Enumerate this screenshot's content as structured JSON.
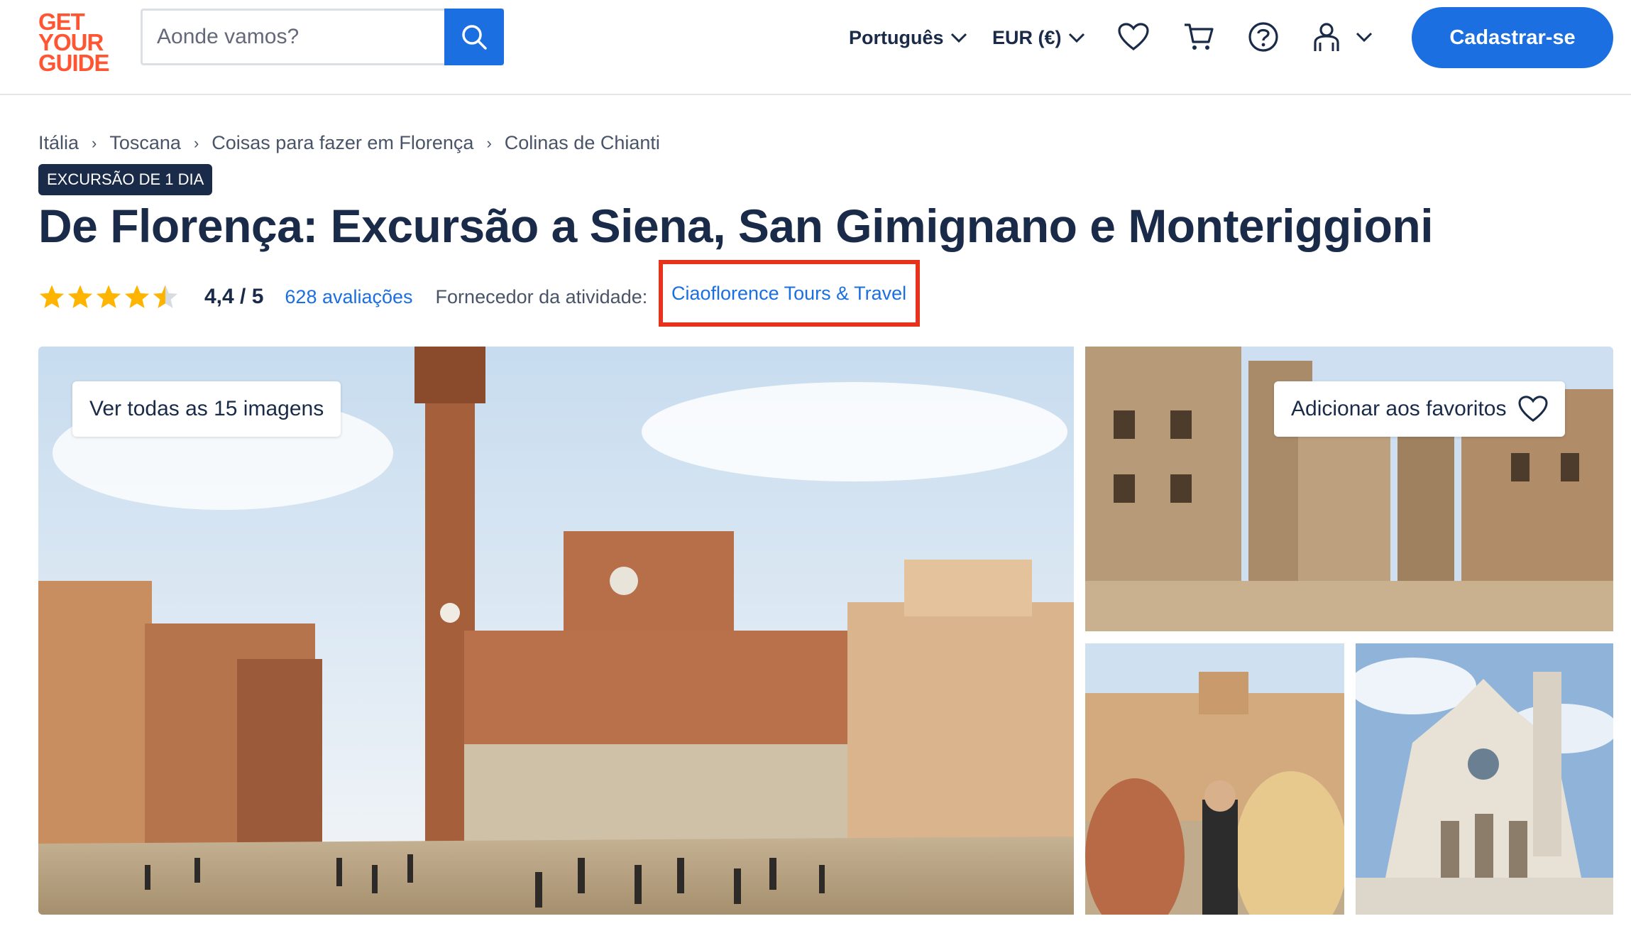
{
  "header": {
    "logo_lines": [
      "GET",
      "YOUR",
      "GUIDE"
    ],
    "search_placeholder": "Aonde vamos?",
    "language": "Português",
    "currency": "EUR (€)",
    "signup_label": "Cadastrar-se"
  },
  "breadcrumb": [
    "Itália",
    "Toscana",
    "Coisas para fazer em Florença",
    "Colinas de Chianti"
  ],
  "badge": "EXCURSÃO DE 1 DIA",
  "title": "De Florença: Excursão a Siena, San Gimignano e Monteriggioni",
  "rating": {
    "value": 4.4,
    "score_text": "4,4 / 5",
    "reviews_text": "628 avaliações",
    "provider_label": "Fornecedor da atividade:",
    "provider_name": "Ciaoflorence Tours & Travel"
  },
  "gallery": {
    "view_all_label": "Ver todas as 15 imagens",
    "favorite_label": "Adicionar aos favoritos"
  },
  "colors": {
    "brand": "#ff5533",
    "primary": "#1b6fe0",
    "text": "#1a2b49",
    "star": "#ffb400",
    "highlight": "#e8331c"
  }
}
